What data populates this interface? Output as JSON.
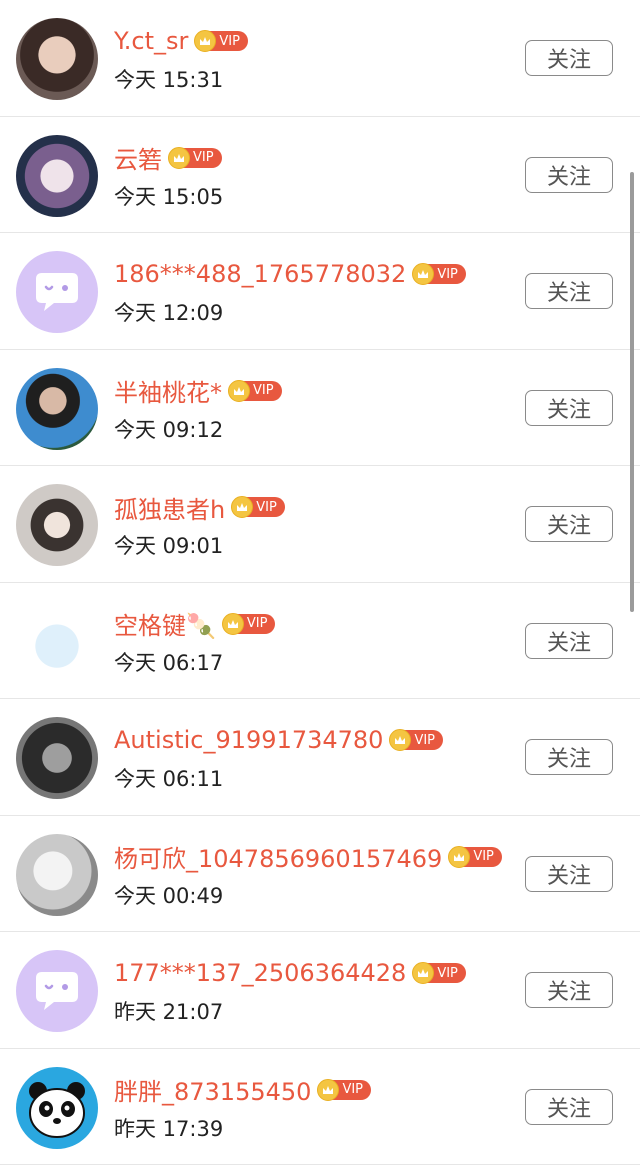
{
  "follow_label": "关注",
  "vip_label": "VIP",
  "colors": {
    "accent": "#e8583f",
    "vip_gold": "#f4c542",
    "default_avatar_bg": "#d7c5f7"
  },
  "users": [
    {
      "name": "Y.ct_sr",
      "time": "今天 15:31",
      "avatar": "photo-avatar"
    },
    {
      "name": "云箬",
      "time": "今天 15:05",
      "avatar": "anime-avatar"
    },
    {
      "name": "186***488_1765778032",
      "time": "今天 12:09",
      "avatar": "default-chat-avatar"
    },
    {
      "name": "半袖桃花*",
      "time": "今天 09:12",
      "avatar": "photo-avatar"
    },
    {
      "name": "孤独患者h",
      "time": "今天 09:01",
      "avatar": "anime-avatar"
    },
    {
      "name": "空格键🍡",
      "time": "今天 06:17",
      "avatar": "illustration-avatar"
    },
    {
      "name": "Autistic_91991734780",
      "time": "今天 06:11",
      "avatar": "photo-avatar"
    },
    {
      "name": "杨可欣_1047856960157469",
      "time": "今天 00:49",
      "avatar": "photo-avatar"
    },
    {
      "name": "177***137_2506364428",
      "time": "昨天 21:07",
      "avatar": "default-chat-avatar"
    },
    {
      "name": "胖胖_873155450",
      "time": "昨天 17:39",
      "avatar": "panda-avatar"
    }
  ]
}
